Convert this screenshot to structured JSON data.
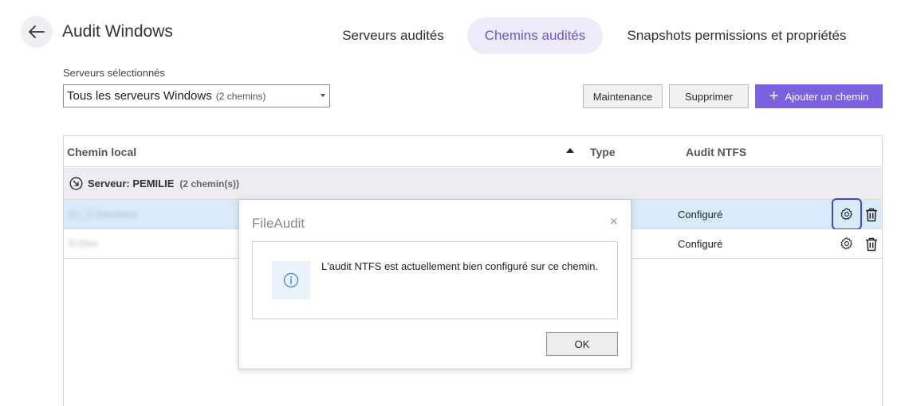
{
  "header": {
    "title": "Audit Windows",
    "back_icon": "arrow-left-icon"
  },
  "tabs": [
    {
      "label": "Serveurs audités",
      "active": false
    },
    {
      "label": "Chemins audités",
      "active": true
    },
    {
      "label": "Snapshots permissions et propriétés",
      "active": false
    }
  ],
  "filter": {
    "label": "Serveurs sélectionnés",
    "selected_value": "Tous les serveurs Windows",
    "selected_sub": "(2 chemins)"
  },
  "toolbar": {
    "maintenance_label": "Maintenance",
    "delete_label": "Supprimer",
    "add_label": "Ajouter un chemin"
  },
  "table": {
    "columns": {
      "path": "Chemin local",
      "type": "Type",
      "ntfs": "Audit NTFS"
    },
    "group": {
      "label": "Serveur: PEMILIE",
      "count": "(2 chemin(s))"
    },
    "rows": [
      {
        "path": "D:\\_G Decisions",
        "ntfs": "Configuré"
      },
      {
        "path": "D:\\Dev",
        "ntfs": "Configuré"
      }
    ]
  },
  "dialog": {
    "title": "FileAudit",
    "close_glyph": "×",
    "message": "L'audit NTFS est actuellement bien configuré sur ce chemin.",
    "ok_label": "OK"
  },
  "colors": {
    "accent": "#7b61e0",
    "active_tab_bg": "#ecebfa",
    "selected_row": "#d9ebfb",
    "focus_ring": "#3f4ac6",
    "info_icon": "#4a90d9"
  }
}
